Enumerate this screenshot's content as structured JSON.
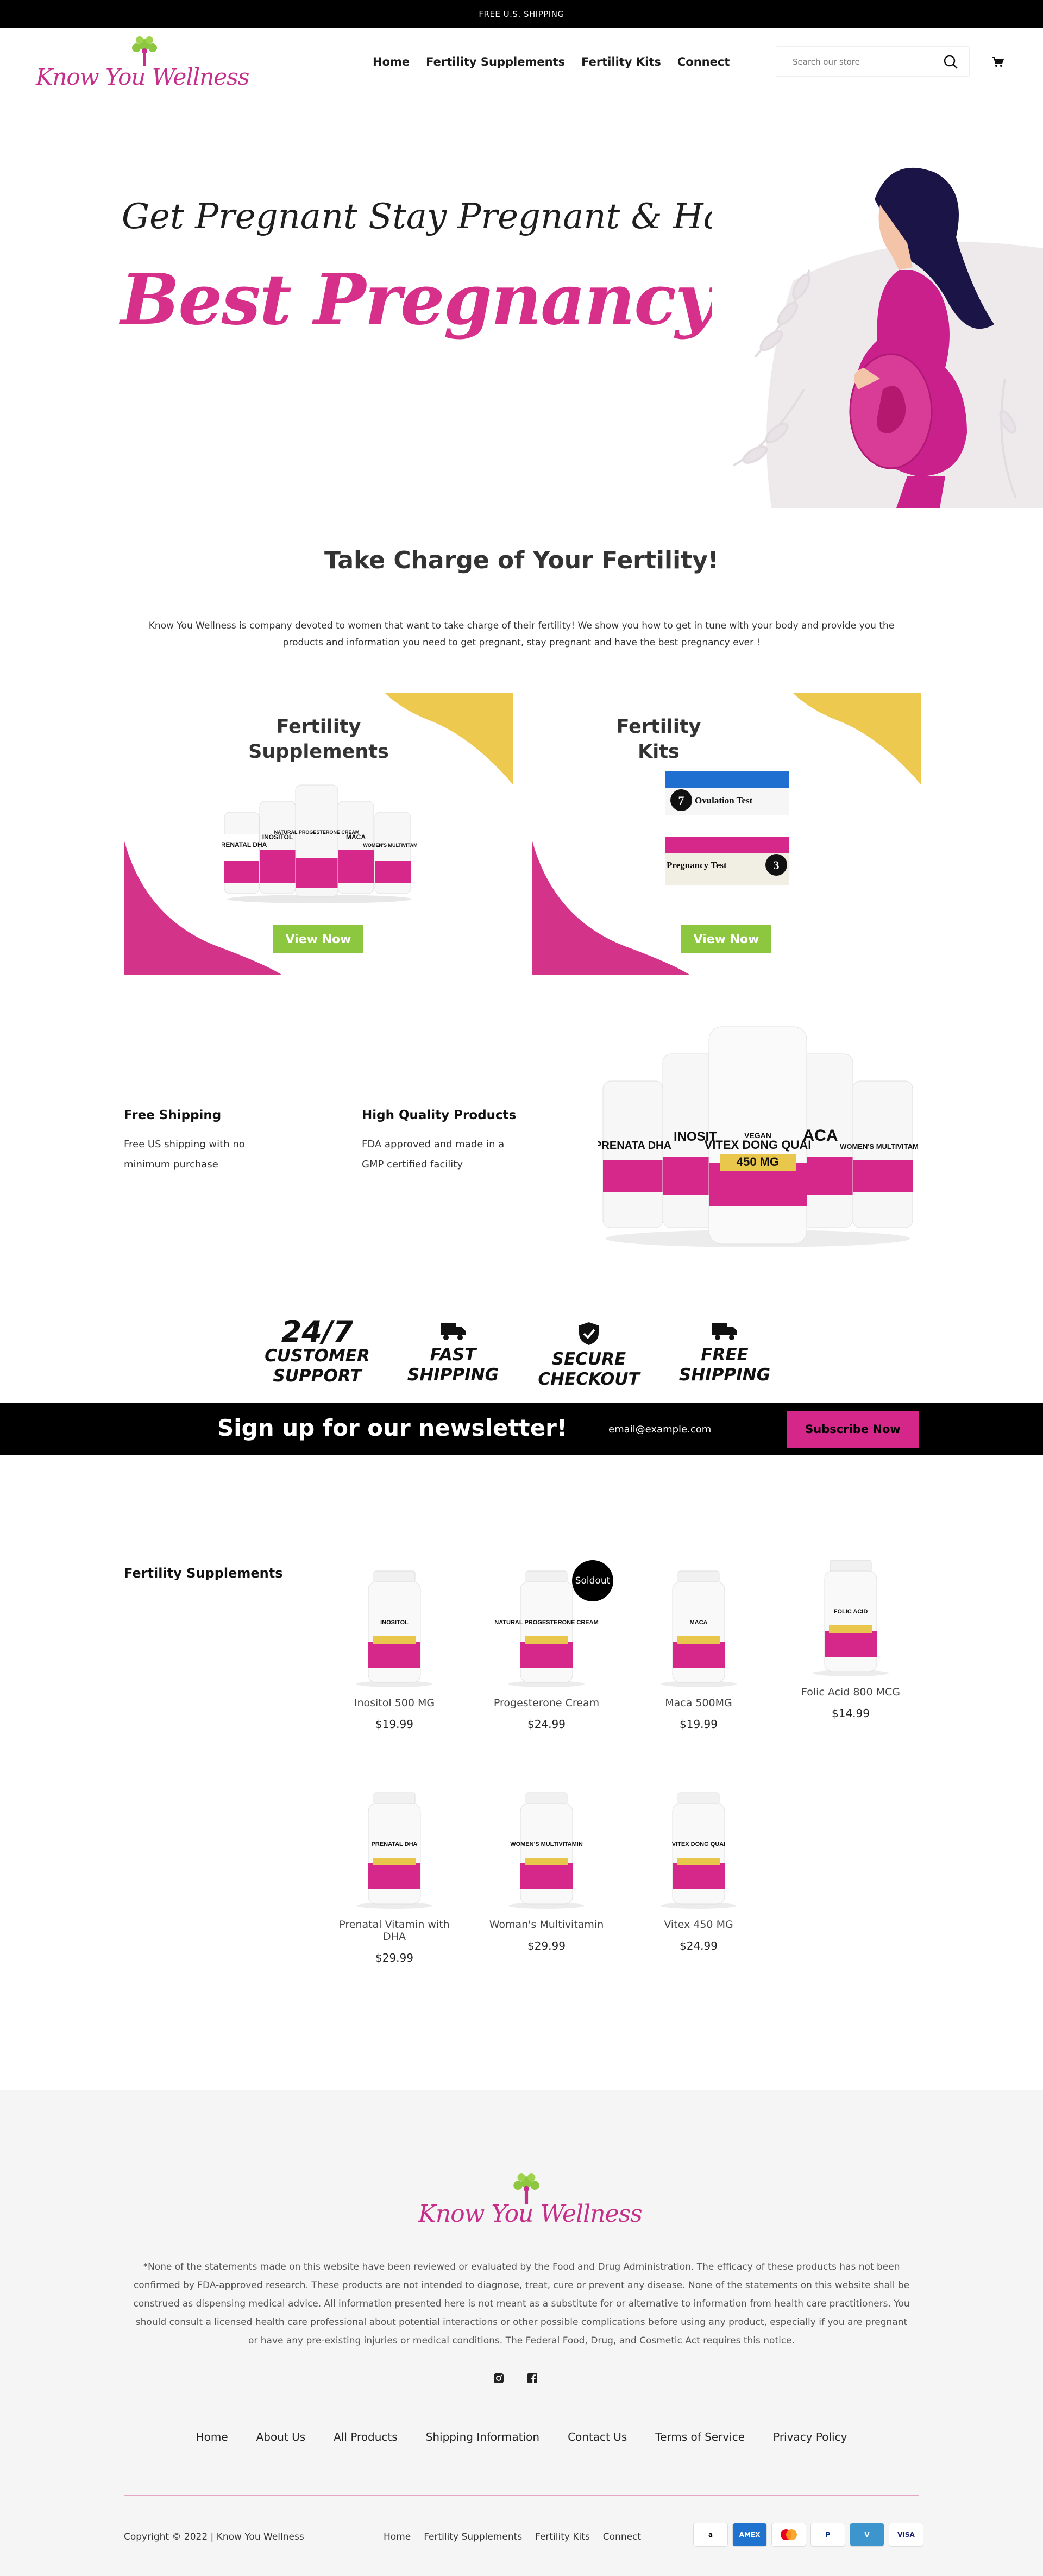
{
  "announcement": "FREE U.S. SHIPPING",
  "brand": "Know You Wellness",
  "nav": [
    "Home",
    "Fertility Supplements",
    "Fertility Kits",
    "Connect"
  ],
  "search": {
    "placeholder": "Search our store"
  },
  "hero": {
    "line1": "Get Pregnant Stay Pregnant & Have the",
    "line2": "Best Pregnancy Ever!"
  },
  "intro": {
    "title": "Take Charge of Your Fertility!",
    "text": "Know You Wellness is company devoted to women that want to take charge of their fertility! We show you how to get in tune with your body and provide you the products and information you need to get pregnant, stay pregnant and have the best pregnancy ever !"
  },
  "cards": [
    {
      "title_line1": "Fertility",
      "title_line2": "Supplements",
      "button": "View Now",
      "bottle_labels": [
        "PRENATAL DHA",
        "INOSITOL",
        "NATURAL PROGESTERONE CREAM",
        "MACA",
        "WOMEN'S MULTIVITAMIN"
      ]
    },
    {
      "title_line1": "Fertility",
      "title_line2": "Kits",
      "button": "View Now",
      "kit_labels": [
        "Ovulation Test",
        "Pregnancy Test"
      ],
      "kit_counts": [
        "7",
        "3"
      ]
    }
  ],
  "features": [
    {
      "title": "Free Shipping",
      "text": "Free US shipping with no minimum purchase"
    },
    {
      "title": "High Quality Products",
      "text": "FDA approved and made in a GMP certified facility"
    }
  ],
  "bottles_big_labels": [
    "PRENATA DHA",
    "INOSIT",
    "VITEX DONG QUAI",
    "450 MG",
    "ACA",
    "WOMEN'S MULTIVITAMIN",
    "VEGAN"
  ],
  "badges": [
    {
      "top": "24/7",
      "line1": "CUSTOMER",
      "line2": "SUPPORT",
      "icon": ""
    },
    {
      "top": "",
      "line1": "FAST",
      "line2": "SHIPPING",
      "icon": "truck-icon"
    },
    {
      "top": "",
      "line1": "SECURE",
      "line2": "CHECKOUT",
      "icon": "shield-check-icon"
    },
    {
      "top": "",
      "line1": "FREE",
      "line2": "SHIPPING",
      "icon": "truck-icon"
    }
  ],
  "newsletter": {
    "title": "Sign up for our newsletter!",
    "placeholder": "email@example.com",
    "button": "Subscribe Now"
  },
  "products_section": "Fertility Supplements",
  "products": [
    {
      "name": "Inositol 500 MG",
      "price": "$19.99",
      "label": "INOSITOL",
      "soldout": ""
    },
    {
      "name": "Progesterone Cream",
      "price": "$24.99",
      "label": "NATURAL PROGESTERONE CREAM",
      "soldout": "Soldout"
    },
    {
      "name": "Maca 500MG",
      "price": "$19.99",
      "label": "MACA",
      "soldout": ""
    },
    {
      "name": "Folic Acid 800 MCG",
      "price": "$14.99",
      "label": "FOLIC ACID",
      "soldout": ""
    },
    {
      "name": "Prenatal Vitamin with DHA",
      "price": "$29.99",
      "label": "PRENATAL DHA",
      "soldout": ""
    },
    {
      "name": "Woman's Multivitamin",
      "price": "$29.99",
      "label": "WOMEN'S MULTIVITAMIN",
      "soldout": ""
    },
    {
      "name": "Vitex 450 MG",
      "price": "$24.99",
      "label": "VITEX DONG QUAI",
      "soldout": ""
    }
  ],
  "footer": {
    "disclaimer": "*None of the statements made on this website have been reviewed or evaluated by the Food and Drug Administration. The efficacy of these products has not been confirmed by FDA-approved research. These products are not intended to diagnose, treat, cure or prevent any disease. None of the statements on this website shall be construed as dispensing medical advice. All information presented here is not meant as a substitute for or alternative to information from health care practitioners.  You should consult a licensed health care professional about potential interactions or other possible complications before using any product, especially if you are pregnant or have any pre-existing injuries or medical conditions. The Federal Food, Drug, and Cosmetic Act requires this notice.",
    "links": [
      "Home",
      "About Us",
      "All Products",
      "Shipping Information",
      "Contact Us",
      "Terms of Service",
      "Privacy Policy"
    ],
    "copyright": "Copyright © 2022 | Know You Wellness",
    "bottom_nav": [
      "Home",
      "Fertility Supplements",
      "Fertility Kits",
      "Connect"
    ],
    "payments": [
      {
        "name": "amazon",
        "text": "a",
        "color": "#000"
      },
      {
        "name": "amex",
        "text": "AMEX",
        "color": "#1f72cd"
      },
      {
        "name": "mastercard",
        "text": "",
        "color": "#eb001b"
      },
      {
        "name": "paypal",
        "text": "P",
        "color": "#003087"
      },
      {
        "name": "venmo",
        "text": "V",
        "color": "#3d95ce"
      },
      {
        "name": "visa",
        "text": "VISA",
        "color": "#1a1f71"
      }
    ]
  },
  "colors": {
    "brand_pink": "#d7308b",
    "green": "#8dc63f",
    "gold": "#e9c74c"
  }
}
